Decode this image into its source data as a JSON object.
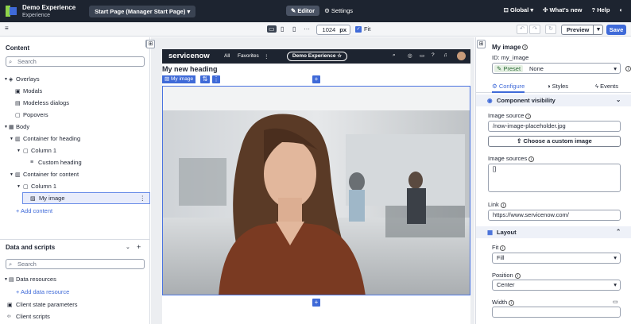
{
  "app": {
    "name": "Demo Experience",
    "type": "Experience",
    "page_selector": "Start Page (Manager Start Page)"
  },
  "topbar": {
    "editor": "Editor",
    "settings": "Settings",
    "global": "Global",
    "whats_new": "What's new",
    "help": "Help"
  },
  "toolbar": {
    "width_value": "1024",
    "width_unit": "px",
    "fit_label": "Fit",
    "preview": "Preview",
    "save": "Save"
  },
  "left_panel": {
    "content_title": "Content",
    "search_placeholder": "Search",
    "tree": {
      "overlays": "Overlays",
      "modals": "Modals",
      "modeless": "Modeless dialogs",
      "popovers": "Popovers",
      "body": "Body",
      "container_heading": "Container for heading",
      "column1a": "Column 1",
      "custom_heading": "Custom heading",
      "container_content": "Container for content",
      "column1b": "Column 1",
      "my_image": "My image",
      "add_content": "+ Add content"
    },
    "data_title": "Data and scripts",
    "data_search_placeholder": "Search",
    "data_tree": {
      "resources": "Data resources",
      "add_resource": "+ Add data resource",
      "client_state": "Client state parameters",
      "client_scripts": "Client scripts"
    }
  },
  "canvas": {
    "nav": {
      "brand": "servicenow",
      "all": "All",
      "favorites": "Favorites",
      "experience": "Demo Experience ☆"
    },
    "heading": "My new heading",
    "image_tab": "My image"
  },
  "right_panel": {
    "title": "My image",
    "id": "ID: my_image",
    "preset_label": "Preset",
    "preset_value": "None",
    "tabs": {
      "configure": "Configure",
      "styles": "Styles",
      "events": "Events"
    },
    "visibility": "Component visibility",
    "image_source_label": "Image source",
    "image_source_value": "/now-image-placeholder.jpg",
    "choose_button": "Choose a custom image",
    "image_sources_label": "Image sources",
    "image_sources_value": "[]",
    "link_label": "Link",
    "link_value": "https://www.servicenow.com/",
    "layout": "Layout",
    "fit_label": "Fit",
    "fit_value": "Fill",
    "position_label": "Position",
    "position_value": "Center",
    "width_label": "Width"
  },
  "colors": {
    "accent": "#3f6ad8",
    "topbar": "#1d2430"
  }
}
